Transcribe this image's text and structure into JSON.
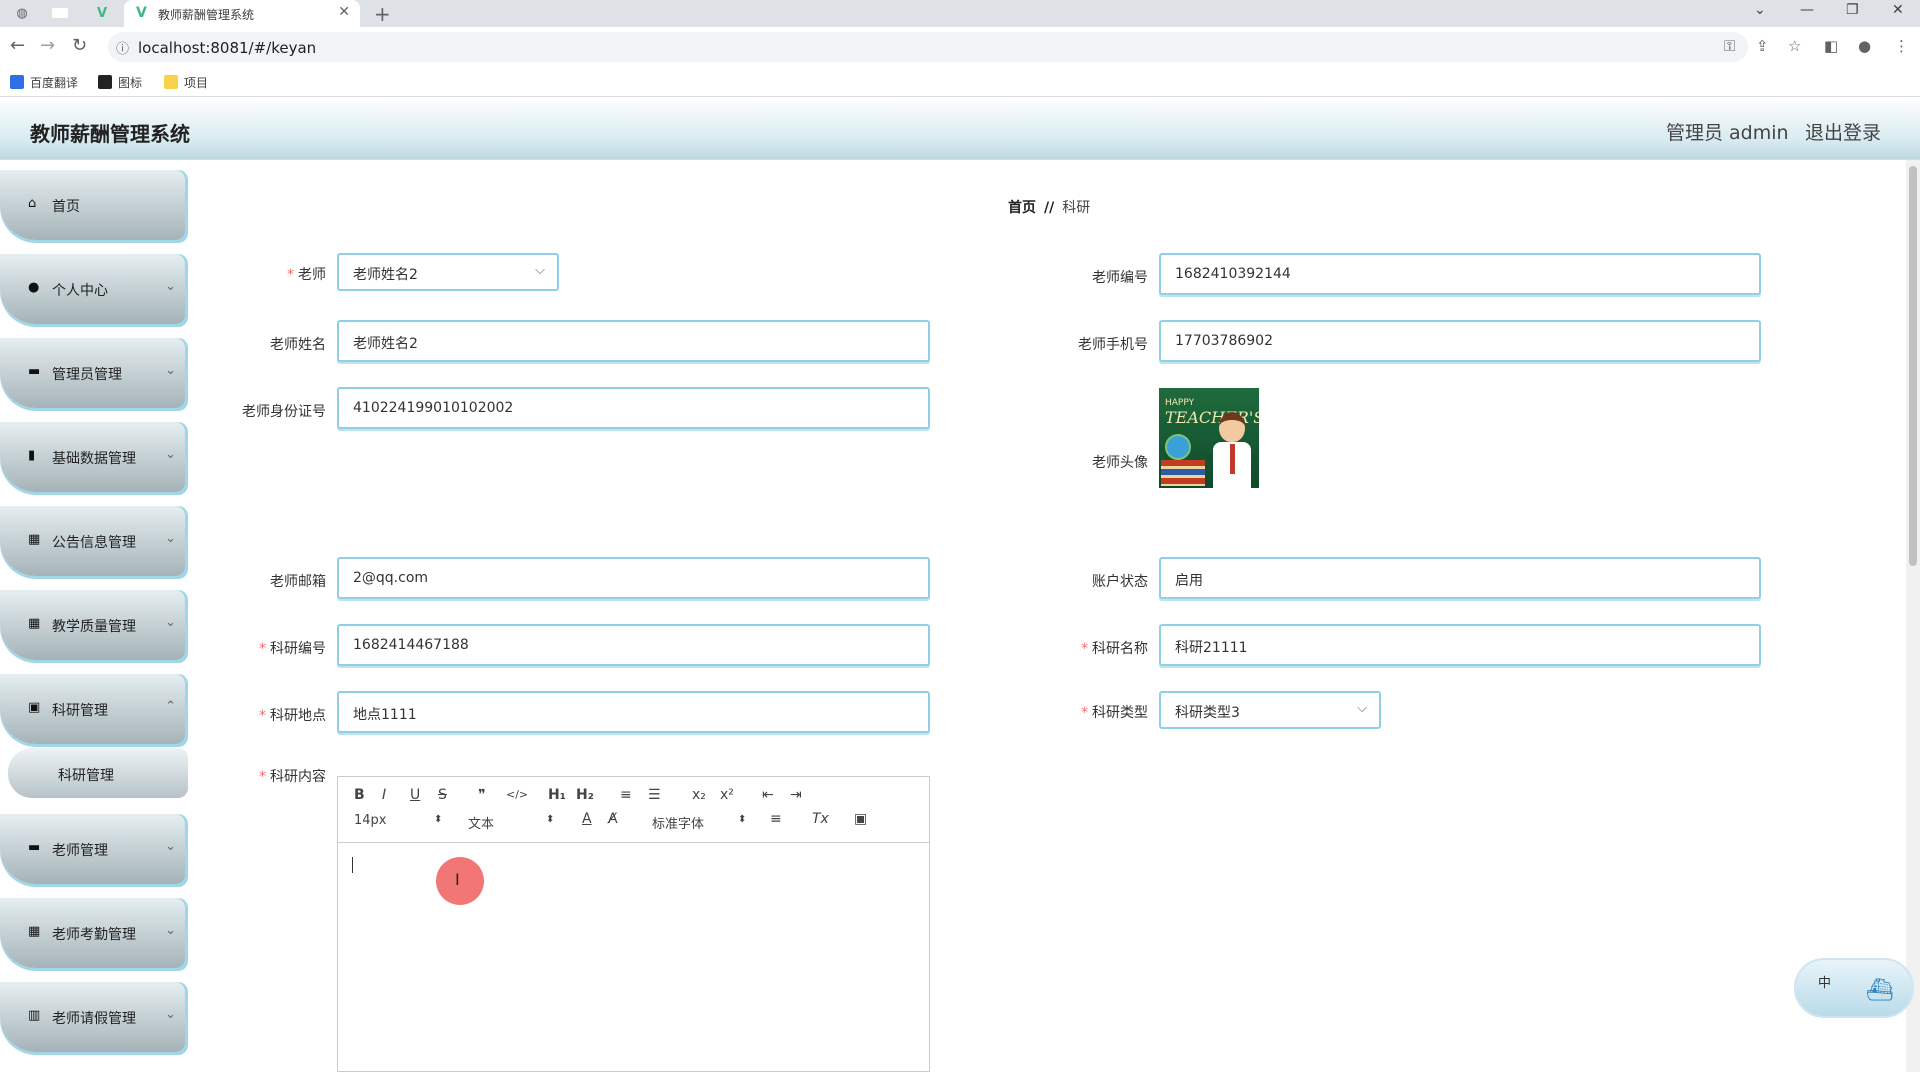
{
  "browser": {
    "tab_title": "教师薪酬管理系统",
    "tab_close": "✕",
    "new_tab": "+",
    "url": "localhost:8081/#/keyan",
    "window_controls": [
      "⌄",
      "—",
      "❐",
      "✕"
    ],
    "bookmarks": [
      {
        "label": "百度翻译",
        "icon": "translate-icon"
      },
      {
        "label": "图标",
        "icon": "image-folder-icon"
      },
      {
        "label": "项目",
        "icon": "folder-icon"
      }
    ]
  },
  "header": {
    "brand": "教师薪酬管理系统",
    "user": "管理员 admin",
    "logout": "退出登录"
  },
  "sidebar": {
    "items": [
      {
        "label": "首页",
        "icon": "home-icon",
        "has_children": false
      },
      {
        "label": "个人中心",
        "icon": "user-icon",
        "has_children": true
      },
      {
        "label": "管理员管理",
        "icon": "briefcase-icon",
        "has_children": true
      },
      {
        "label": "基础数据管理",
        "icon": "clipboard-icon",
        "has_children": true
      },
      {
        "label": "公告信息管理",
        "icon": "grid-icon",
        "has_children": true
      },
      {
        "label": "教学质量管理",
        "icon": "grid-icon",
        "has_children": true
      },
      {
        "label": "科研管理",
        "icon": "calendar-icon",
        "has_children": true,
        "expanded": true
      },
      {
        "label": "老师管理",
        "icon": "book-icon",
        "has_children": true
      },
      {
        "label": "老师考勤管理",
        "icon": "grid-icon",
        "has_children": true
      },
      {
        "label": "老师请假管理",
        "icon": "bar-chart-icon",
        "has_children": true
      }
    ],
    "sub_item": "科研管理"
  },
  "breadcrumb": {
    "home": "首页",
    "separator": "//",
    "current": "科研"
  },
  "form": {
    "teacher_label": "老师",
    "teacher_value": "老师姓名2",
    "teacher_no_label": "老师编号",
    "teacher_no_value": "1682410392144",
    "teacher_name_label": "老师姓名",
    "teacher_name_value": "老师姓名2",
    "teacher_phone_label": "老师手机号",
    "teacher_phone_value": "17703786902",
    "teacher_id_label": "老师身份证号",
    "teacher_id_value": "410224199010102002",
    "teacher_avatar_label": "老师头像",
    "avatar_text_small": "HAPPY",
    "avatar_text_big": "TEACHER'S",
    "teacher_email_label": "老师邮箱",
    "teacher_email_value": "2@qq.com",
    "account_status_label": "账户状态",
    "account_status_value": "启用",
    "research_no_label": "科研编号",
    "research_no_value": "1682414467188",
    "research_name_label": "科研名称",
    "research_name_value": "科研21111",
    "research_place_label": "科研地点",
    "research_place_value": "地点1111",
    "research_type_label": "科研类型",
    "research_type_value": "科研类型3",
    "research_content_label": "科研内容"
  },
  "editor": {
    "buttons": [
      "B",
      "I",
      "U",
      "S",
      "❞",
      "</>",
      "H₁",
      "H₂",
      "≡",
      "☰",
      "x₂",
      "x²",
      "⇤",
      "⇥"
    ],
    "font_size": "14px",
    "format": "文本",
    "font_family": "标准字体",
    "extra_buttons": [
      "A",
      "A̸",
      "≡",
      "Tx",
      "▣"
    ]
  },
  "ime": {
    "label": "中"
  }
}
